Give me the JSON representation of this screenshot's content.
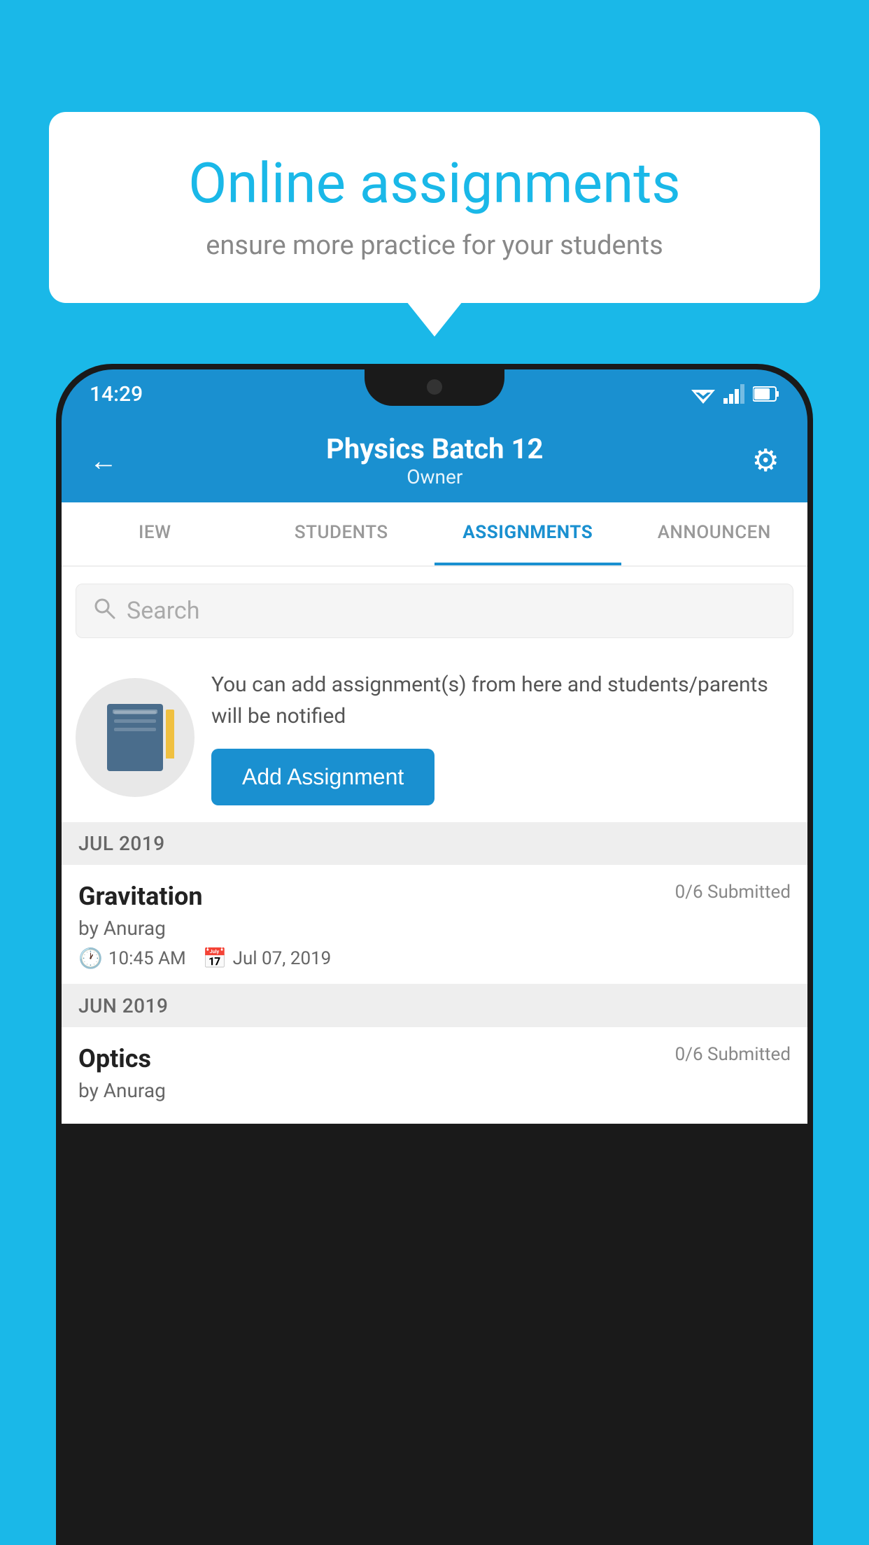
{
  "background_color": "#1ab8e8",
  "speech_bubble": {
    "title": "Online assignments",
    "subtitle": "ensure more practice for your students"
  },
  "phone": {
    "status_bar": {
      "time": "14:29"
    },
    "header": {
      "title": "Physics Batch 12",
      "subtitle": "Owner",
      "back_icon": "←",
      "settings_icon": "⚙"
    },
    "tabs": [
      {
        "label": "IEW",
        "active": false
      },
      {
        "label": "STUDENTS",
        "active": false
      },
      {
        "label": "ASSIGNMENTS",
        "active": true
      },
      {
        "label": "ANNOUNCEN",
        "active": false
      }
    ],
    "search": {
      "placeholder": "Search"
    },
    "promo": {
      "description": "You can add assignment(s) from here and students/parents will be notified",
      "button_label": "Add Assignment"
    },
    "sections": [
      {
        "month": "JUL 2019",
        "assignments": [
          {
            "name": "Gravitation",
            "submitted": "0/6 Submitted",
            "by": "by Anurag",
            "time": "10:45 AM",
            "date": "Jul 07, 2019"
          }
        ]
      },
      {
        "month": "JUN 2019",
        "assignments": [
          {
            "name": "Optics",
            "submitted": "0/6 Submitted",
            "by": "by Anurag",
            "time": "",
            "date": ""
          }
        ]
      }
    ]
  }
}
